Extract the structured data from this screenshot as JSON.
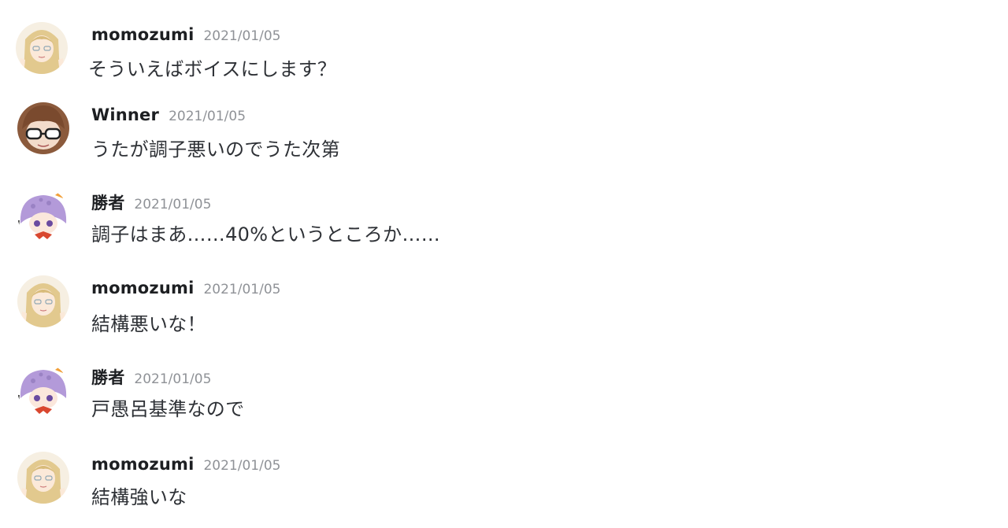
{
  "messages": [
    {
      "author": "momozumi",
      "timestamp": "2021/01/05",
      "text": "そういえばボイスにします？",
      "avatar": "blonde-girl-avatar"
    },
    {
      "author": "Winner",
      "timestamp": "2021/01/05",
      "text": "うたが調子悪いのでうた次第",
      "avatar": "brown-hair-glasses-avatar"
    },
    {
      "author": "勝者",
      "timestamp": "2021/01/05",
      "text": "調子はまあ……40%というところか……",
      "avatar": "purple-hair-girl-avatar"
    },
    {
      "author": "momozumi",
      "timestamp": "2021/01/05",
      "text": "結構悪いな！",
      "avatar": "blonde-girl-avatar"
    },
    {
      "author": "勝者",
      "timestamp": "2021/01/05",
      "text": "戸愚呂基準なので",
      "avatar": "purple-hair-girl-avatar"
    },
    {
      "author": "momozumi",
      "timestamp": "2021/01/05",
      "text": "結構強いな",
      "avatar": "blonde-girl-avatar"
    }
  ]
}
